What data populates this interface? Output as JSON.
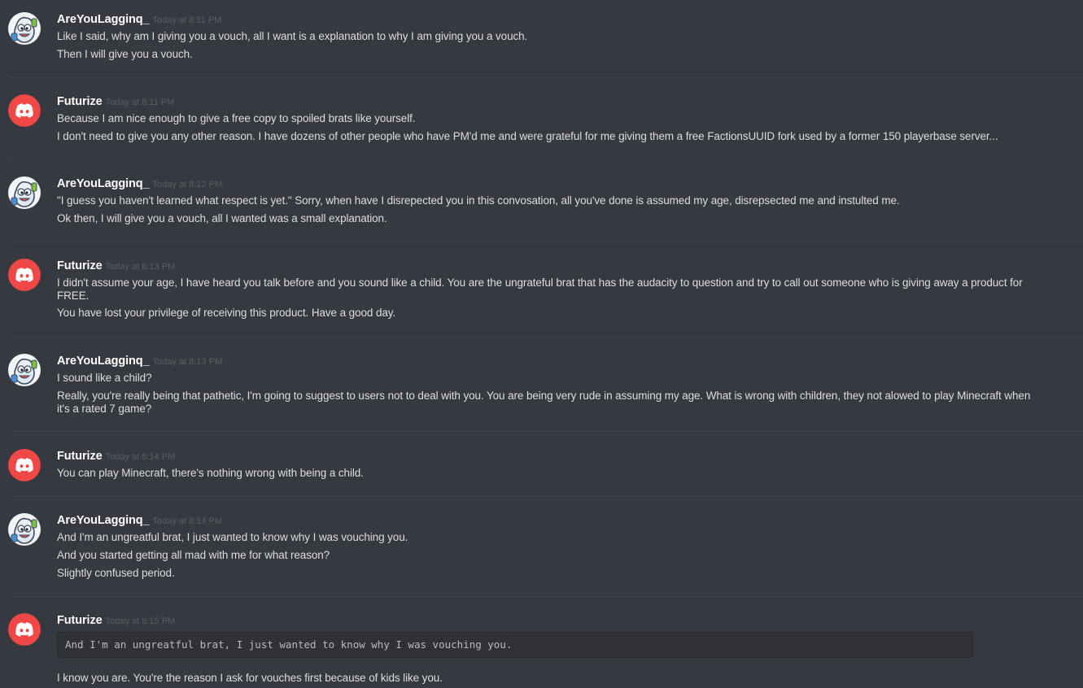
{
  "colors": {
    "background": "#36393f",
    "discord_red": "#f04747",
    "text": "#dcddde",
    "username": "#ffffff",
    "timestamp": "#5b5e64"
  },
  "messages": [
    {
      "username": "AreYouLagginq_",
      "timestamp": "Today at 8:11 PM",
      "avatar": "cartoon-avatar-icon",
      "lines": [
        "Like I said, why am I giving you a vouch, all I want is a explanation to why I am giving you a vouch.",
        "Then I will give you a vouch."
      ]
    },
    {
      "username": "Futurize",
      "timestamp": "Today at 8:11 PM",
      "avatar": "discord-logo-icon",
      "lines": [
        "Because I am nice enough to give a free copy to spoiled brats like yourself.",
        "I don't need to give you any other reason.  I have dozens of other people who have PM'd me and were grateful for me giving them a free FactionsUUID fork used by a former 150 playerbase server..."
      ]
    },
    {
      "username": "AreYouLagginq_",
      "timestamp": "Today at 8:12 PM",
      "avatar": "cartoon-avatar-icon",
      "lines": [
        "\"I guess you haven't learned what respect is yet.\" Sorry, when have I disrepected you in this convosation, all you've done is assumed my age, disrepsected me and instulted me.",
        "Ok then, I will give you a vouch, all I wanted was a small explanation."
      ]
    },
    {
      "username": "Futurize",
      "timestamp": "Today at 8:13 PM",
      "avatar": "discord-logo-icon",
      "lines": [
        "I didn't assume your age, I have heard you talk before and you sound like a child.  You are the ungrateful brat that has the audacity to question and try to call out someone who is giving away a product for FREE.",
        "You have lost your privilege of receiving this product.  Have a good day."
      ]
    },
    {
      "username": "AreYouLagginq_",
      "timestamp": "Today at 8:13 PM",
      "avatar": "cartoon-avatar-icon",
      "lines": [
        "I sound like a child?",
        "Really, you're really being that pathetic, I'm going to suggest to users not to deal with you. You are being very rude in assuming my age. What is wrong with children, they not alowed to play Minecraft when it's a rated 7 game?"
      ]
    },
    {
      "username": "Futurize",
      "timestamp": "Today at 8:14 PM",
      "avatar": "discord-logo-icon",
      "lines": [
        "You can play Minecraft, there's nothing wrong with being a child."
      ]
    },
    {
      "username": "AreYouLagginq_",
      "timestamp": "Today at 8:14 PM",
      "avatar": "cartoon-avatar-icon",
      "lines": [
        "And I'm an ungreatful brat, I just wanted to know why I was vouching you.",
        "And you started getting all mad with me for what reason?",
        "Slightly confused period."
      ]
    },
    {
      "username": "Futurize",
      "timestamp": "Today at 8:15 PM",
      "avatar": "discord-logo-icon",
      "code": "And I'm an ungreatful brat, I just wanted to know why I was vouching you.",
      "lines": [
        "I know you are.  You're the reason I ask for vouches first because of kids like you."
      ]
    }
  ]
}
